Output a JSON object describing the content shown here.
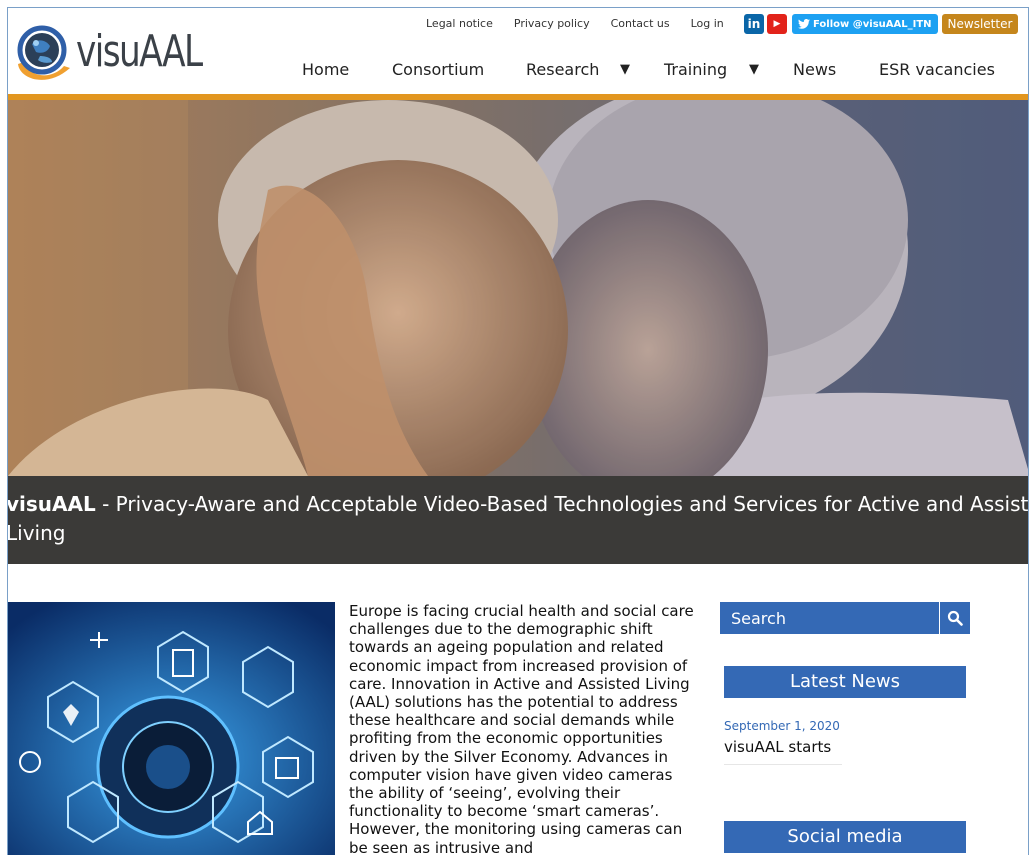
{
  "header": {
    "logo_text": "visuAAL",
    "top_links": [
      "Legal notice",
      "Privacy policy",
      "Contact us",
      "Log in"
    ],
    "social": {
      "linkedin": "in",
      "youtube": "▶",
      "twitter_label": "Follow @visuAAL_ITN",
      "newsletter_label": "Newsletter"
    },
    "nav": {
      "home": "Home",
      "consortium": "Consortium",
      "research": "Research",
      "training": "Training",
      "news": "News",
      "vacancies": "ESR vacancies",
      "caret": "▼"
    }
  },
  "hero": {
    "caption_bold": "visuAAL",
    "caption_rest": " - Privacy-Aware and Acceptable Video-Based Technologies and Services for Active and Assisted",
    "caption_line2": "Living"
  },
  "article": {
    "text": "Europe is facing crucial health and social care challenges due to the demographic shift towards an ageing population and related economic impact from increased provision of care. Innovation in Active and Assisted Living (AAL) solutions has the potential to address these healthcare and social demands while profiting from the economic opportunities driven by the Silver Economy. Advances in computer vision have given video cameras the ability of ‘seeing’, evolving their functionality to become ‘smart cameras’. However, the monitoring using cameras can be seen as intrusive and"
  },
  "sidebar": {
    "search_placeholder": "Search",
    "latest_news_title": "Latest News",
    "news_items": [
      {
        "date": "September 1, 2020",
        "title": "visuAAL starts"
      }
    ],
    "social_media_title": "Social media"
  },
  "colors": {
    "accent_blue": "#3469b5",
    "gold": "#e2961f",
    "caption_bg": "#3b3a38"
  }
}
